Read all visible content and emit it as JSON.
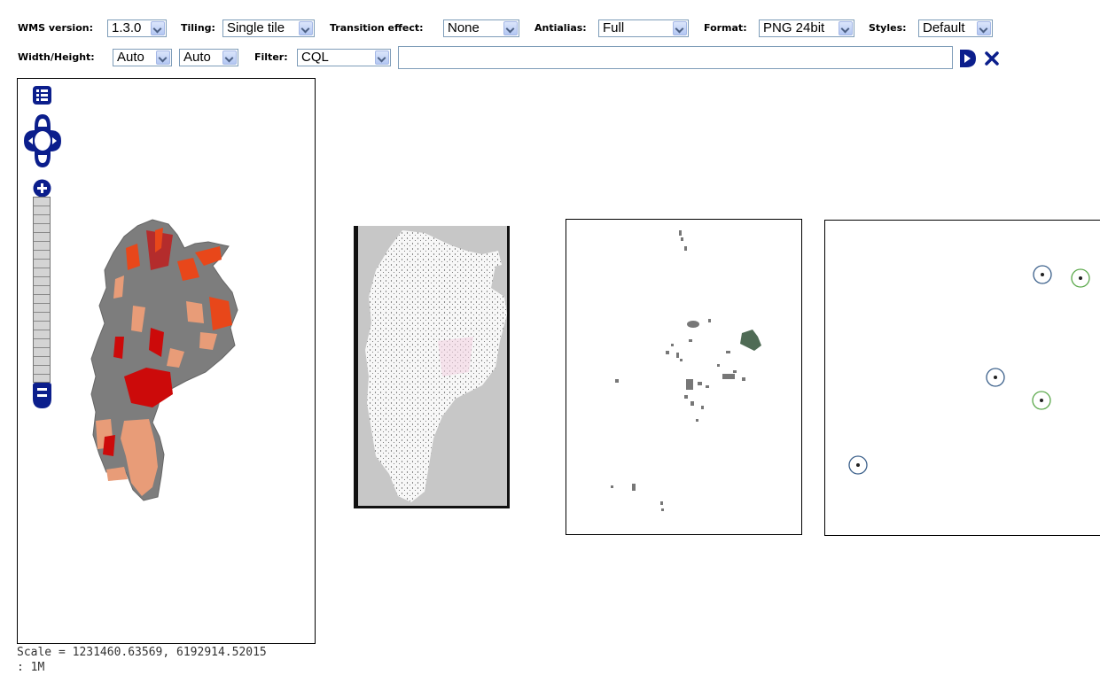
{
  "toolbar": {
    "wms_version": {
      "label": "WMS version:",
      "value": "1.3.0"
    },
    "tiling": {
      "label": "Tiling:",
      "value": "Single tile"
    },
    "transition_effect": {
      "label": "Transition effect:",
      "value": "None"
    },
    "antialias": {
      "label": "Antialias:",
      "value": "Full"
    },
    "format": {
      "label": "Format:",
      "value": "PNG 24bit"
    },
    "styles": {
      "label": "Styles:",
      "value": "Default"
    },
    "width_height": {
      "label": "Width/Height:",
      "width_value": "Auto",
      "height_value": "Auto"
    },
    "filter": {
      "label": "Filter:",
      "value": "CQL",
      "expression": ""
    },
    "apply_icon": "play-icon",
    "reset_icon": "close-icon"
  },
  "map": {
    "scale_text": "Scale = 1231460.63569, 6192914.52015",
    "scale_text_2": ": 1M",
    "controls": [
      "layer-switcher-icon",
      "pan-up-icon",
      "pan-left-icon",
      "pan-right-icon",
      "pan-down-icon",
      "zoom-in-icon",
      "zoom-out-icon"
    ]
  },
  "colors": {
    "nav_blue": "#0b1e8c",
    "land_gray": "#7d7d7d",
    "red": "#cc0a0a",
    "orange_red": "#e8471a",
    "salmon": "#e89c78",
    "point_blue": "#3a5f8a",
    "point_green": "#5aa84a",
    "patch_dark": "#4f6b55"
  }
}
